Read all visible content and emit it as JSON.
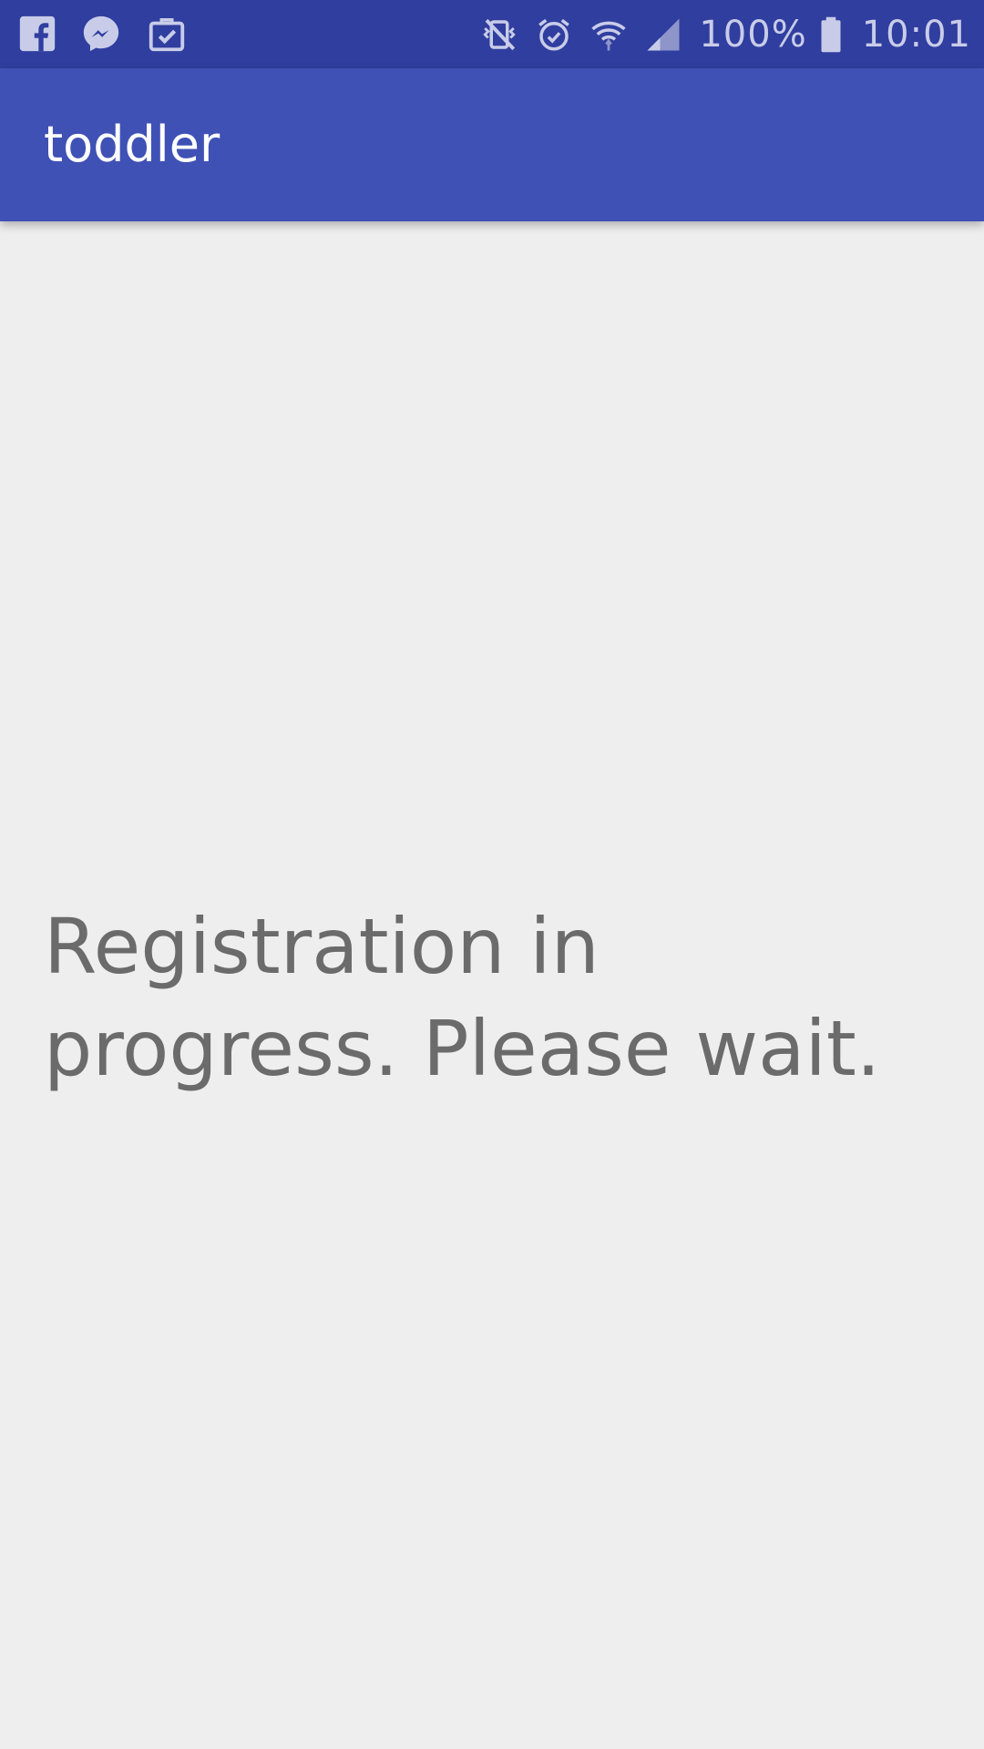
{
  "status_bar": {
    "left_icons": [
      "facebook-icon",
      "messenger-icon",
      "briefcase-check-icon"
    ],
    "right_icons": [
      "vibrate-mute-icon",
      "alarm-icon",
      "wifi-icon",
      "signal-icon"
    ],
    "battery_text": "100%",
    "time": "10:01"
  },
  "app_bar": {
    "title": "toddler"
  },
  "main": {
    "message": "Registration in progress. Please wait."
  },
  "colors": {
    "status_bar": "#2f3e9f",
    "app_bar": "#3f51b5",
    "background": "#eeeeef",
    "message_text": "#6b6b6b"
  }
}
